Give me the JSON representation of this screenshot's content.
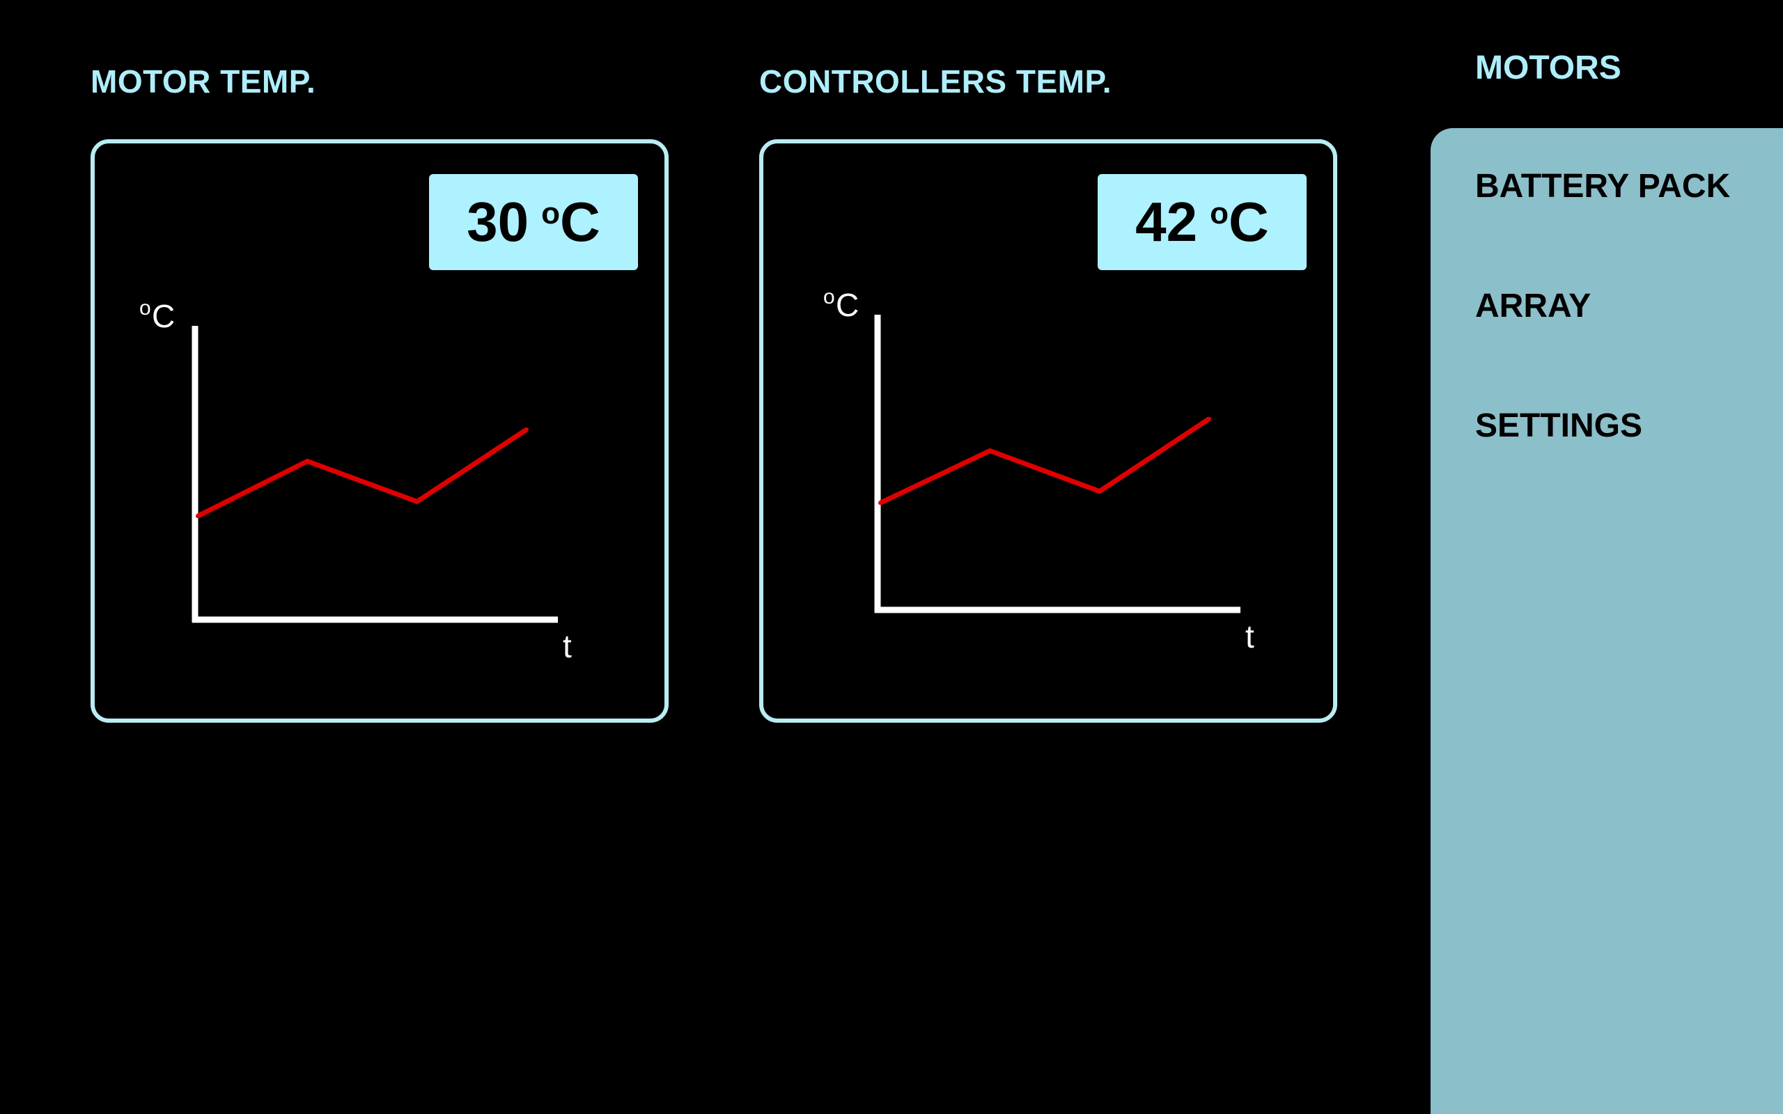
{
  "panels": {
    "motor": {
      "title": "MOTOR TEMP.",
      "readout_value": "30",
      "readout_unit": "C",
      "readout_degree": "o",
      "y_axis_label": "C",
      "y_axis_degree": "o",
      "x_axis_label": "t"
    },
    "controllers": {
      "title": "CONTROLLERS TEMP.",
      "readout_value": "42",
      "readout_unit": "C",
      "readout_degree": "o",
      "y_axis_label": "C",
      "y_axis_degree": "o",
      "x_axis_label": "t"
    }
  },
  "sidebar": {
    "active": "MOTORS",
    "items": [
      {
        "label": "BATTERY PACK"
      },
      {
        "label": "ARRAY"
      },
      {
        "label": "SETTINGS"
      }
    ]
  },
  "colors": {
    "background": "#000000",
    "accent": "#aeeefa",
    "card_border": "#b9ecf3",
    "readout_bg": "#aef1ff",
    "sidebar_bg": "#8bbfca",
    "series_line": "#e00000",
    "axis": "#ffffff"
  },
  "chart_data": [
    {
      "type": "line",
      "xlabel": "t",
      "ylabel": "°C",
      "series": [
        {
          "values": [
            0.35,
            0.54,
            0.4,
            0.65
          ]
        }
      ],
      "ylim": [
        0,
        1
      ]
    },
    {
      "type": "line",
      "xlabel": "t",
      "ylabel": "°C",
      "series": [
        {
          "values": [
            0.36,
            0.54,
            0.4,
            0.65
          ]
        }
      ],
      "ylim": [
        0,
        1
      ]
    }
  ]
}
